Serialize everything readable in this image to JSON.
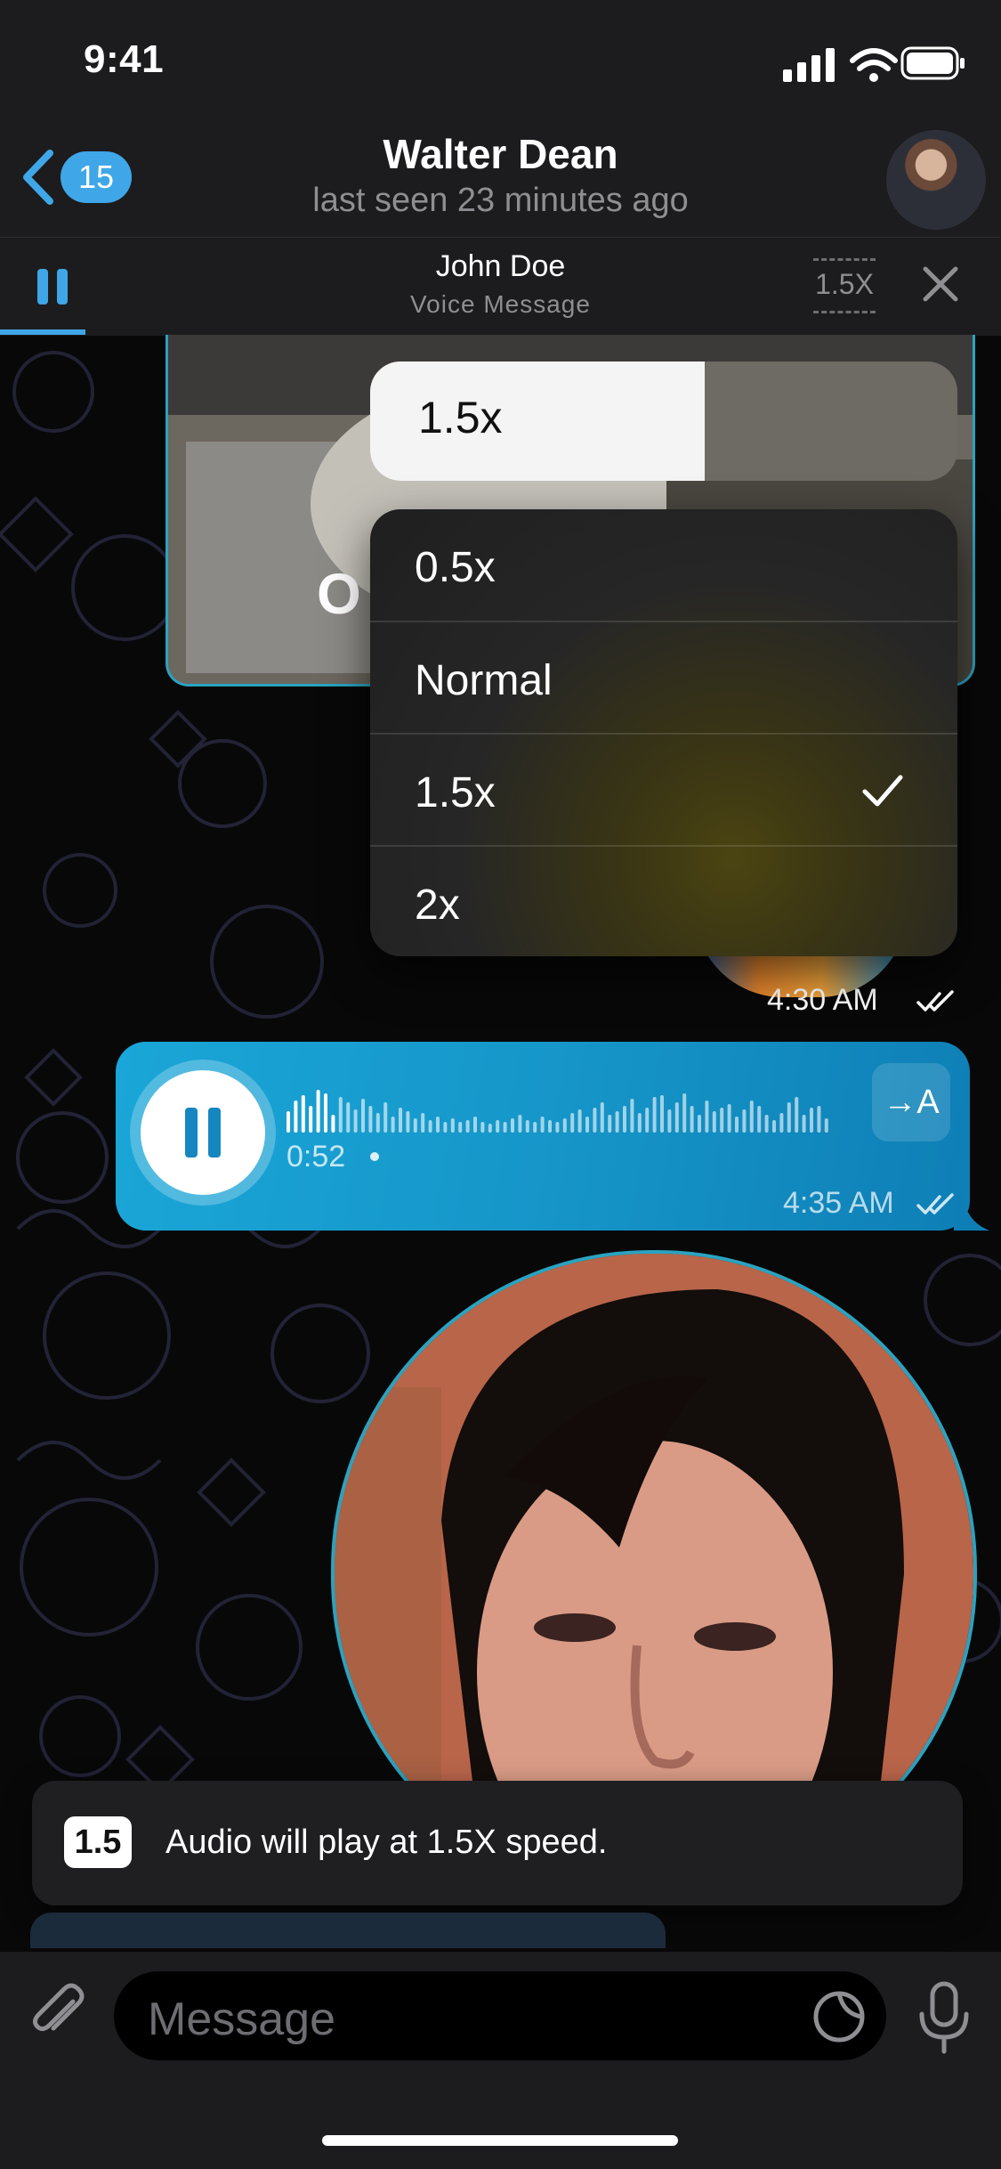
{
  "status": {
    "time": "9:41"
  },
  "header": {
    "back_count": "15",
    "title": "Walter Dean",
    "subtitle": "last seen 23 minutes ago"
  },
  "player": {
    "name": "John Doe",
    "subtitle": "Voice Message",
    "speed_label": "1.5X",
    "progress_fraction": 0.085
  },
  "video_top": {
    "caption_letter": "O"
  },
  "speed_menu": {
    "slider_value_label": "1.5x",
    "slider_fraction": 0.57,
    "items": [
      {
        "label": "0.5x",
        "selected": false
      },
      {
        "label": "Normal",
        "selected": false
      },
      {
        "label": "1.5x",
        "selected": true
      },
      {
        "label": "2x",
        "selected": false
      }
    ]
  },
  "prev_message": {
    "time": "4:30 AM"
  },
  "voice_message": {
    "duration": "0:52",
    "time": "4:35 AM",
    "translate_label": "→A"
  },
  "toast": {
    "badge": "1.5",
    "text": "Audio will play at 1.5X speed."
  },
  "input": {
    "placeholder": "Message"
  },
  "colors": {
    "accent": "#3fa7e8",
    "bubble": "#1696c9",
    "header_bg": "#1c1c1e"
  }
}
